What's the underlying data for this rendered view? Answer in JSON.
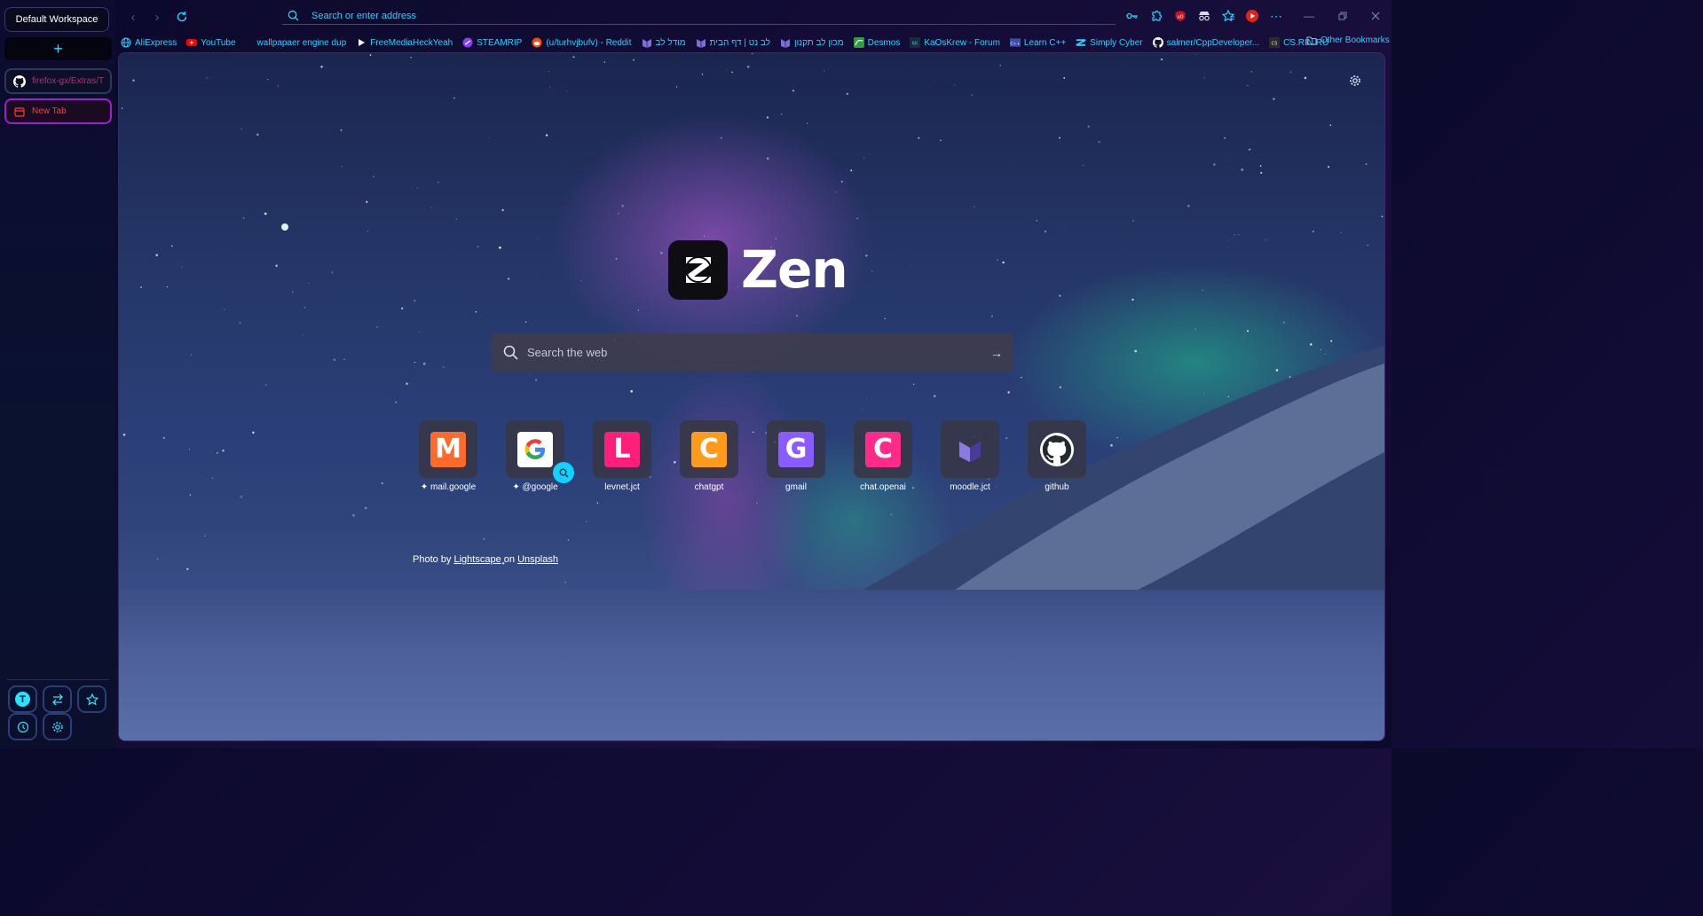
{
  "sidebar": {
    "workspace_label": "Default Workspace",
    "new_tab_label": "+",
    "tabs": [
      {
        "title": "firefox-gx/Extras/T",
        "icon": "github-icon"
      },
      {
        "title": "New Tab",
        "icon": "calendar-icon"
      }
    ],
    "bottom_buttons": [
      "profile-icon",
      "swap-icon",
      "star-icon",
      "history-icon",
      "gear-icon"
    ],
    "profile_letter": "T"
  },
  "toolbar": {
    "address_placeholder": "Search or enter address",
    "icons": [
      "key-icon",
      "extensions-icon",
      "ublock-icon",
      "spy-icon",
      "bookmark-star-icon",
      "youtube-icon",
      "more-icon"
    ]
  },
  "bookmarks": [
    {
      "label": "AliExpress",
      "icon": "globe-icon"
    },
    {
      "label": "YouTube",
      "icon": "youtube-icon"
    },
    {
      "label": "wallpapaer engine dup",
      "icon": "none"
    },
    {
      "label": "FreeMediaHeckYeah",
      "icon": "play-icon"
    },
    {
      "label": "STEAMRIP",
      "icon": "steamrip-icon"
    },
    {
      "label": "(u/turhvjbufv) - Reddit",
      "icon": "reddit-icon"
    },
    {
      "label": "מודל לב",
      "icon": "moodle-icon"
    },
    {
      "label": "לב נט | דף הבית",
      "icon": "moodle-icon"
    },
    {
      "label": "מכון לב תקנון",
      "icon": "moodle-icon"
    },
    {
      "label": "Desmos",
      "icon": "desmos-icon"
    },
    {
      "label": "KaOsKrew - Forum",
      "icon": "kaos-icon"
    },
    {
      "label": "Learn C++",
      "icon": "learncpp-icon"
    },
    {
      "label": "Simply Cyber",
      "icon": "simplycyber-icon"
    },
    {
      "label": "salmer/CppDeveloper...",
      "icon": "github-icon"
    },
    {
      "label": "CS.RIN.RU",
      "icon": "csrin-icon"
    }
  ],
  "other_bookmarks": "Other Bookmarks",
  "newtab": {
    "logo_text": "Zen",
    "search_placeholder": "Search the web",
    "shortcuts": [
      {
        "label": "mail.google",
        "letter": "M",
        "color": "#ff6a2a",
        "pinned": true
      },
      {
        "label": "@google",
        "letter": "G",
        "color": "#ffffff",
        "pinned": true
      },
      {
        "label": "levnet.jct",
        "letter": "L",
        "color": "#ff1f7a",
        "pinned": false
      },
      {
        "label": "chatgpt",
        "letter": "C",
        "color": "#ff9a1a",
        "pinned": false
      },
      {
        "label": "gmail",
        "letter": "G",
        "color": "#8a5cff",
        "pinned": false
      },
      {
        "label": "chat.openai",
        "letter": "C",
        "color": "#ff2a8a",
        "pinned": false
      },
      {
        "label": "moodle.jct",
        "letter": "",
        "color": "#3a3a4a",
        "pinned": false
      },
      {
        "label": "github",
        "letter": "",
        "color": "#3a3a4a",
        "pinned": false
      }
    ],
    "credit": {
      "prefix": "Photo by",
      "author": "Lightscape",
      "middle": "on",
      "site": "Unsplash"
    }
  }
}
